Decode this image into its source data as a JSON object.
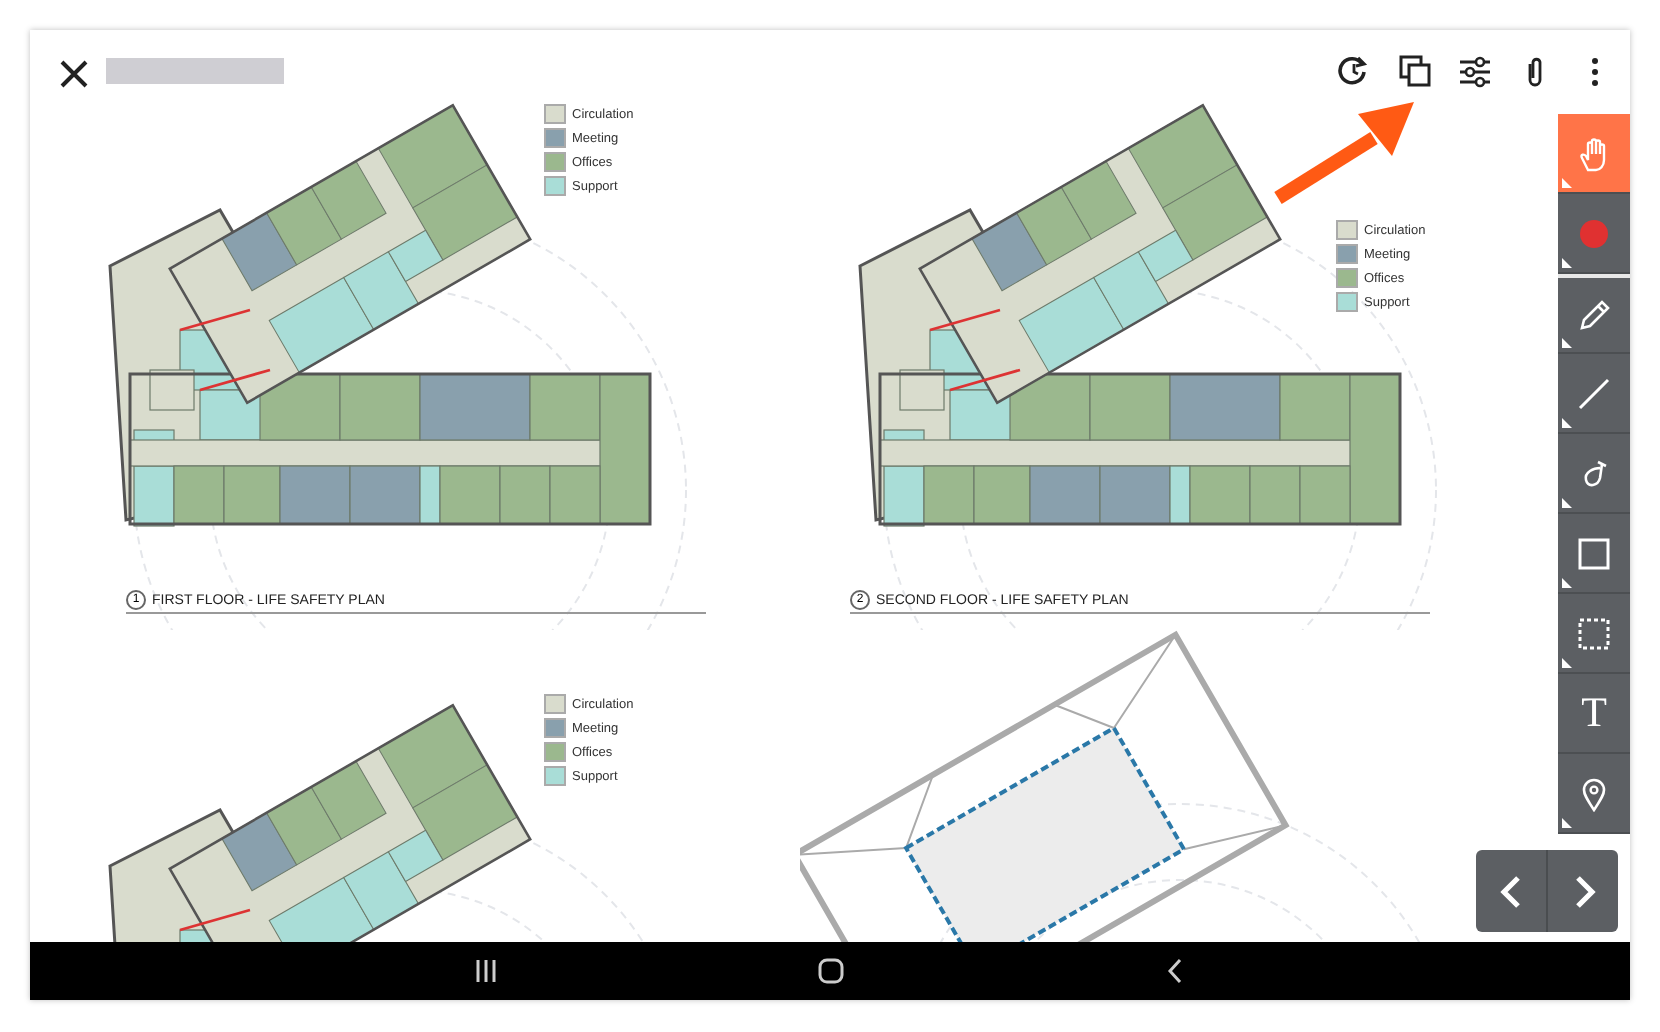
{
  "header": {
    "actions": [
      {
        "kind": "history"
      },
      {
        "kind": "compare"
      },
      {
        "kind": "filters"
      },
      {
        "kind": "attach"
      },
      {
        "kind": "more"
      }
    ]
  },
  "callout": {
    "shown": true
  },
  "sheets": [
    {
      "kind": "floor",
      "number": "1",
      "title": "FIRST FLOOR - LIFE SAFETY PLAN",
      "legend": [
        {
          "label": "Circulation",
          "color": "#d9dccd"
        },
        {
          "label": "Meeting",
          "color": "#89a0ad"
        },
        {
          "label": "Offices",
          "color": "#9bb88e"
        },
        {
          "label": "Support",
          "color": "#a9ddd7"
        }
      ]
    },
    {
      "kind": "floor",
      "number": "2",
      "title": "SECOND FLOOR - LIFE SAFETY PLAN",
      "legend": [
        {
          "label": "Circulation",
          "color": "#d9dccd"
        },
        {
          "label": "Meeting",
          "color": "#89a0ad"
        },
        {
          "label": "Offices",
          "color": "#9bb88e"
        },
        {
          "label": "Support",
          "color": "#a9ddd7"
        }
      ]
    },
    {
      "kind": "floor",
      "legend": [
        {
          "label": "Circulation",
          "color": "#d9dccd"
        },
        {
          "label": "Meeting",
          "color": "#89a0ad"
        },
        {
          "label": "Offices",
          "color": "#9bb88e"
        },
        {
          "label": "Support",
          "color": "#a9ddd7"
        }
      ]
    },
    {
      "kind": "roof"
    }
  ],
  "tools": [
    {
      "kind": "hand",
      "selected": true
    },
    {
      "kind": "color",
      "selected": false
    },
    {
      "kind": "pencil",
      "selected": false
    },
    {
      "kind": "line",
      "selected": false
    },
    {
      "kind": "lasso",
      "selected": false
    },
    {
      "kind": "rectangle",
      "selected": false
    },
    {
      "kind": "selection",
      "selected": false
    },
    {
      "kind": "text",
      "label": "T",
      "selected": false
    },
    {
      "kind": "pin",
      "selected": false
    }
  ],
  "pager": [
    {
      "kind": "prev"
    },
    {
      "kind": "next"
    }
  ],
  "system_nav": [
    {
      "kind": "recents"
    },
    {
      "kind": "home"
    },
    {
      "kind": "back"
    }
  ]
}
